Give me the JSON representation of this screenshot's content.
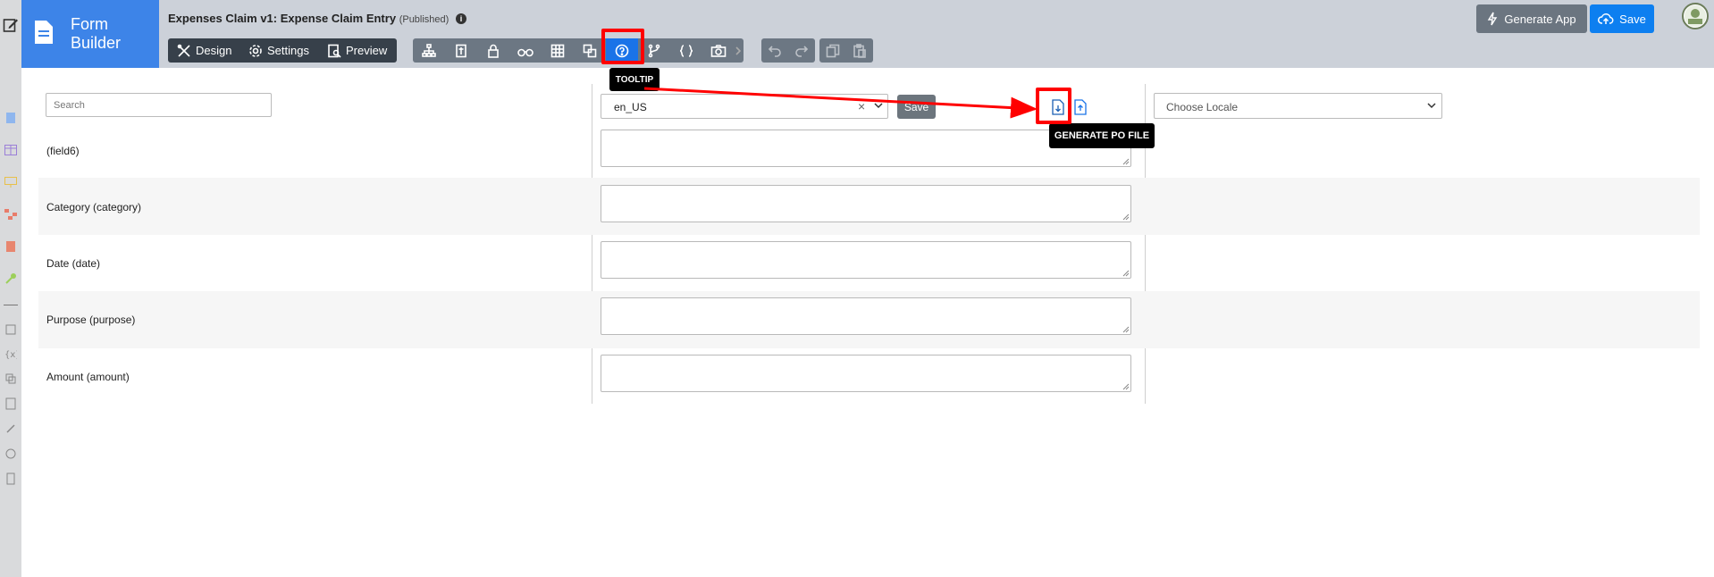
{
  "brand": {
    "title_line1": "Form",
    "title_line2": "Builder"
  },
  "form": {
    "title": "Expenses Claim v1: Expense Claim Entry",
    "status": "(Published)"
  },
  "tabs": [
    {
      "label": "Design",
      "icon": "design-icon"
    },
    {
      "label": "Settings",
      "icon": "gear-icon"
    },
    {
      "label": "Preview",
      "icon": "preview-icon"
    }
  ],
  "toolbar": {
    "icons": [
      "tree-icon",
      "properties-icon",
      "lock-icon",
      "binoculars-icon",
      "grid-icon",
      "translate-icon",
      "help-icon",
      "branch-icon",
      "braces-icon",
      "camera-icon"
    ],
    "active": "help-icon"
  },
  "history": {
    "icons": [
      "undo-icon",
      "redo-icon"
    ]
  },
  "clipboard": {
    "icons": [
      "copy-icon",
      "paste-icon"
    ]
  },
  "actions": {
    "generate_app": "Generate App",
    "save": "Save"
  },
  "search": {
    "placeholder": "Search"
  },
  "locale": {
    "value": "en_US",
    "save": "Save",
    "choose_placeholder": "Choose Locale"
  },
  "tooltips": {
    "toolbar": "TOOLTIP",
    "po": "GENERATE PO FILE"
  },
  "fields": [
    {
      "label": "(field6)",
      "value": ""
    },
    {
      "label": "Category (category)",
      "value": ""
    },
    {
      "label": "Date (date)",
      "value": ""
    },
    {
      "label": "Purpose (purpose)",
      "value": ""
    },
    {
      "label": "Amount (amount)",
      "value": ""
    }
  ],
  "colors": {
    "brand": "#3d84e8",
    "accent": "#0d7ff0",
    "highlight": "#ff0000",
    "header": "#ccd1d9"
  }
}
